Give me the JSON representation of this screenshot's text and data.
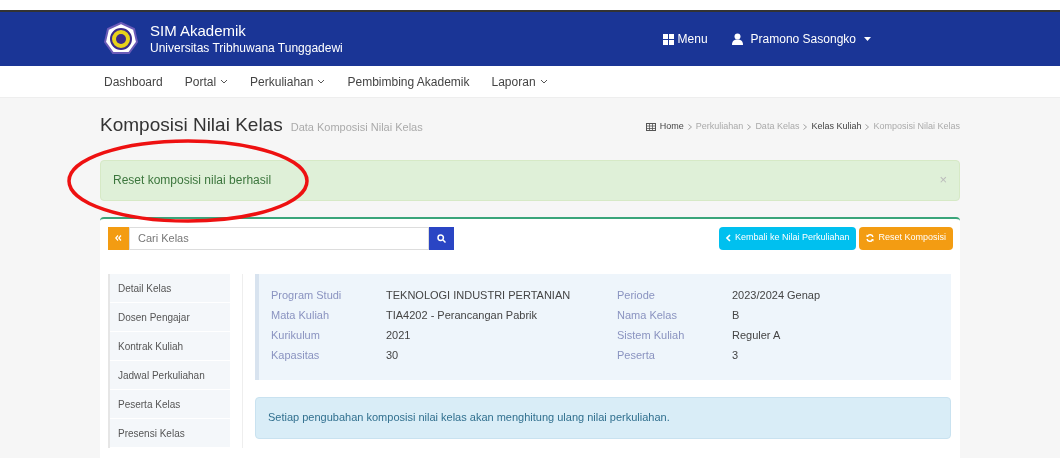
{
  "header": {
    "app_name": "SIM Akademik",
    "university": "Universitas Tribhuwana Tunggadewi",
    "menu_label": "Menu",
    "user_name": "Pramono Sasongko"
  },
  "nav": [
    {
      "label": "Dashboard",
      "dropdown": false
    },
    {
      "label": "Portal",
      "dropdown": true
    },
    {
      "label": "Perkuliahan",
      "dropdown": true
    },
    {
      "label": "Pembimbing Akademik",
      "dropdown": false
    },
    {
      "label": "Laporan",
      "dropdown": true
    }
  ],
  "page": {
    "title": "Komposisi Nilai Kelas",
    "subtitle": "Data Komposisi Nilai Kelas"
  },
  "breadcrumb": [
    {
      "label": "Home",
      "kind": "home"
    },
    {
      "label": "Perkuliahan",
      "kind": "muted"
    },
    {
      "label": "Data Kelas",
      "kind": "muted"
    },
    {
      "label": "Kelas Kuliah",
      "kind": "strong"
    },
    {
      "label": "Komposisi Nilai Kelas",
      "kind": "muted"
    }
  ],
  "alert": {
    "message": "Reset komposisi nilai berhasil",
    "close": "×"
  },
  "search": {
    "placeholder": "Cari Kelas"
  },
  "actions": [
    {
      "label": "Kembali ke Nilai Perkuliahan",
      "kind": "back"
    },
    {
      "label": "Reset Komposisi",
      "kind": "reset"
    }
  ],
  "sidebar": [
    "Detail Kelas",
    "Dosen Pengajar",
    "Kontrak Kuliah",
    "Jadwal Perkuliahan",
    "Peserta Kelas",
    "Presensi Kelas"
  ],
  "details_left": [
    {
      "label": "Program Studi",
      "value": "TEKNOLOGI INDUSTRI PERTANIAN"
    },
    {
      "label": "Mata Kuliah",
      "value": "TIA4202 - Perancangan Pabrik"
    },
    {
      "label": "Kurikulum",
      "value": "2021"
    },
    {
      "label": "Kapasitas",
      "value": "30"
    }
  ],
  "details_right": [
    {
      "label": "Periode",
      "value": "2023/2024 Genap"
    },
    {
      "label": "Nama Kelas",
      "value": "B"
    },
    {
      "label": "Sistem Kuliah",
      "value": "Reguler A"
    },
    {
      "label": "Peserta",
      "value": "3"
    }
  ],
  "notice": "Setiap pengubahan komposisi nilai kelas akan menghitung ulang nilai perkuliahan."
}
